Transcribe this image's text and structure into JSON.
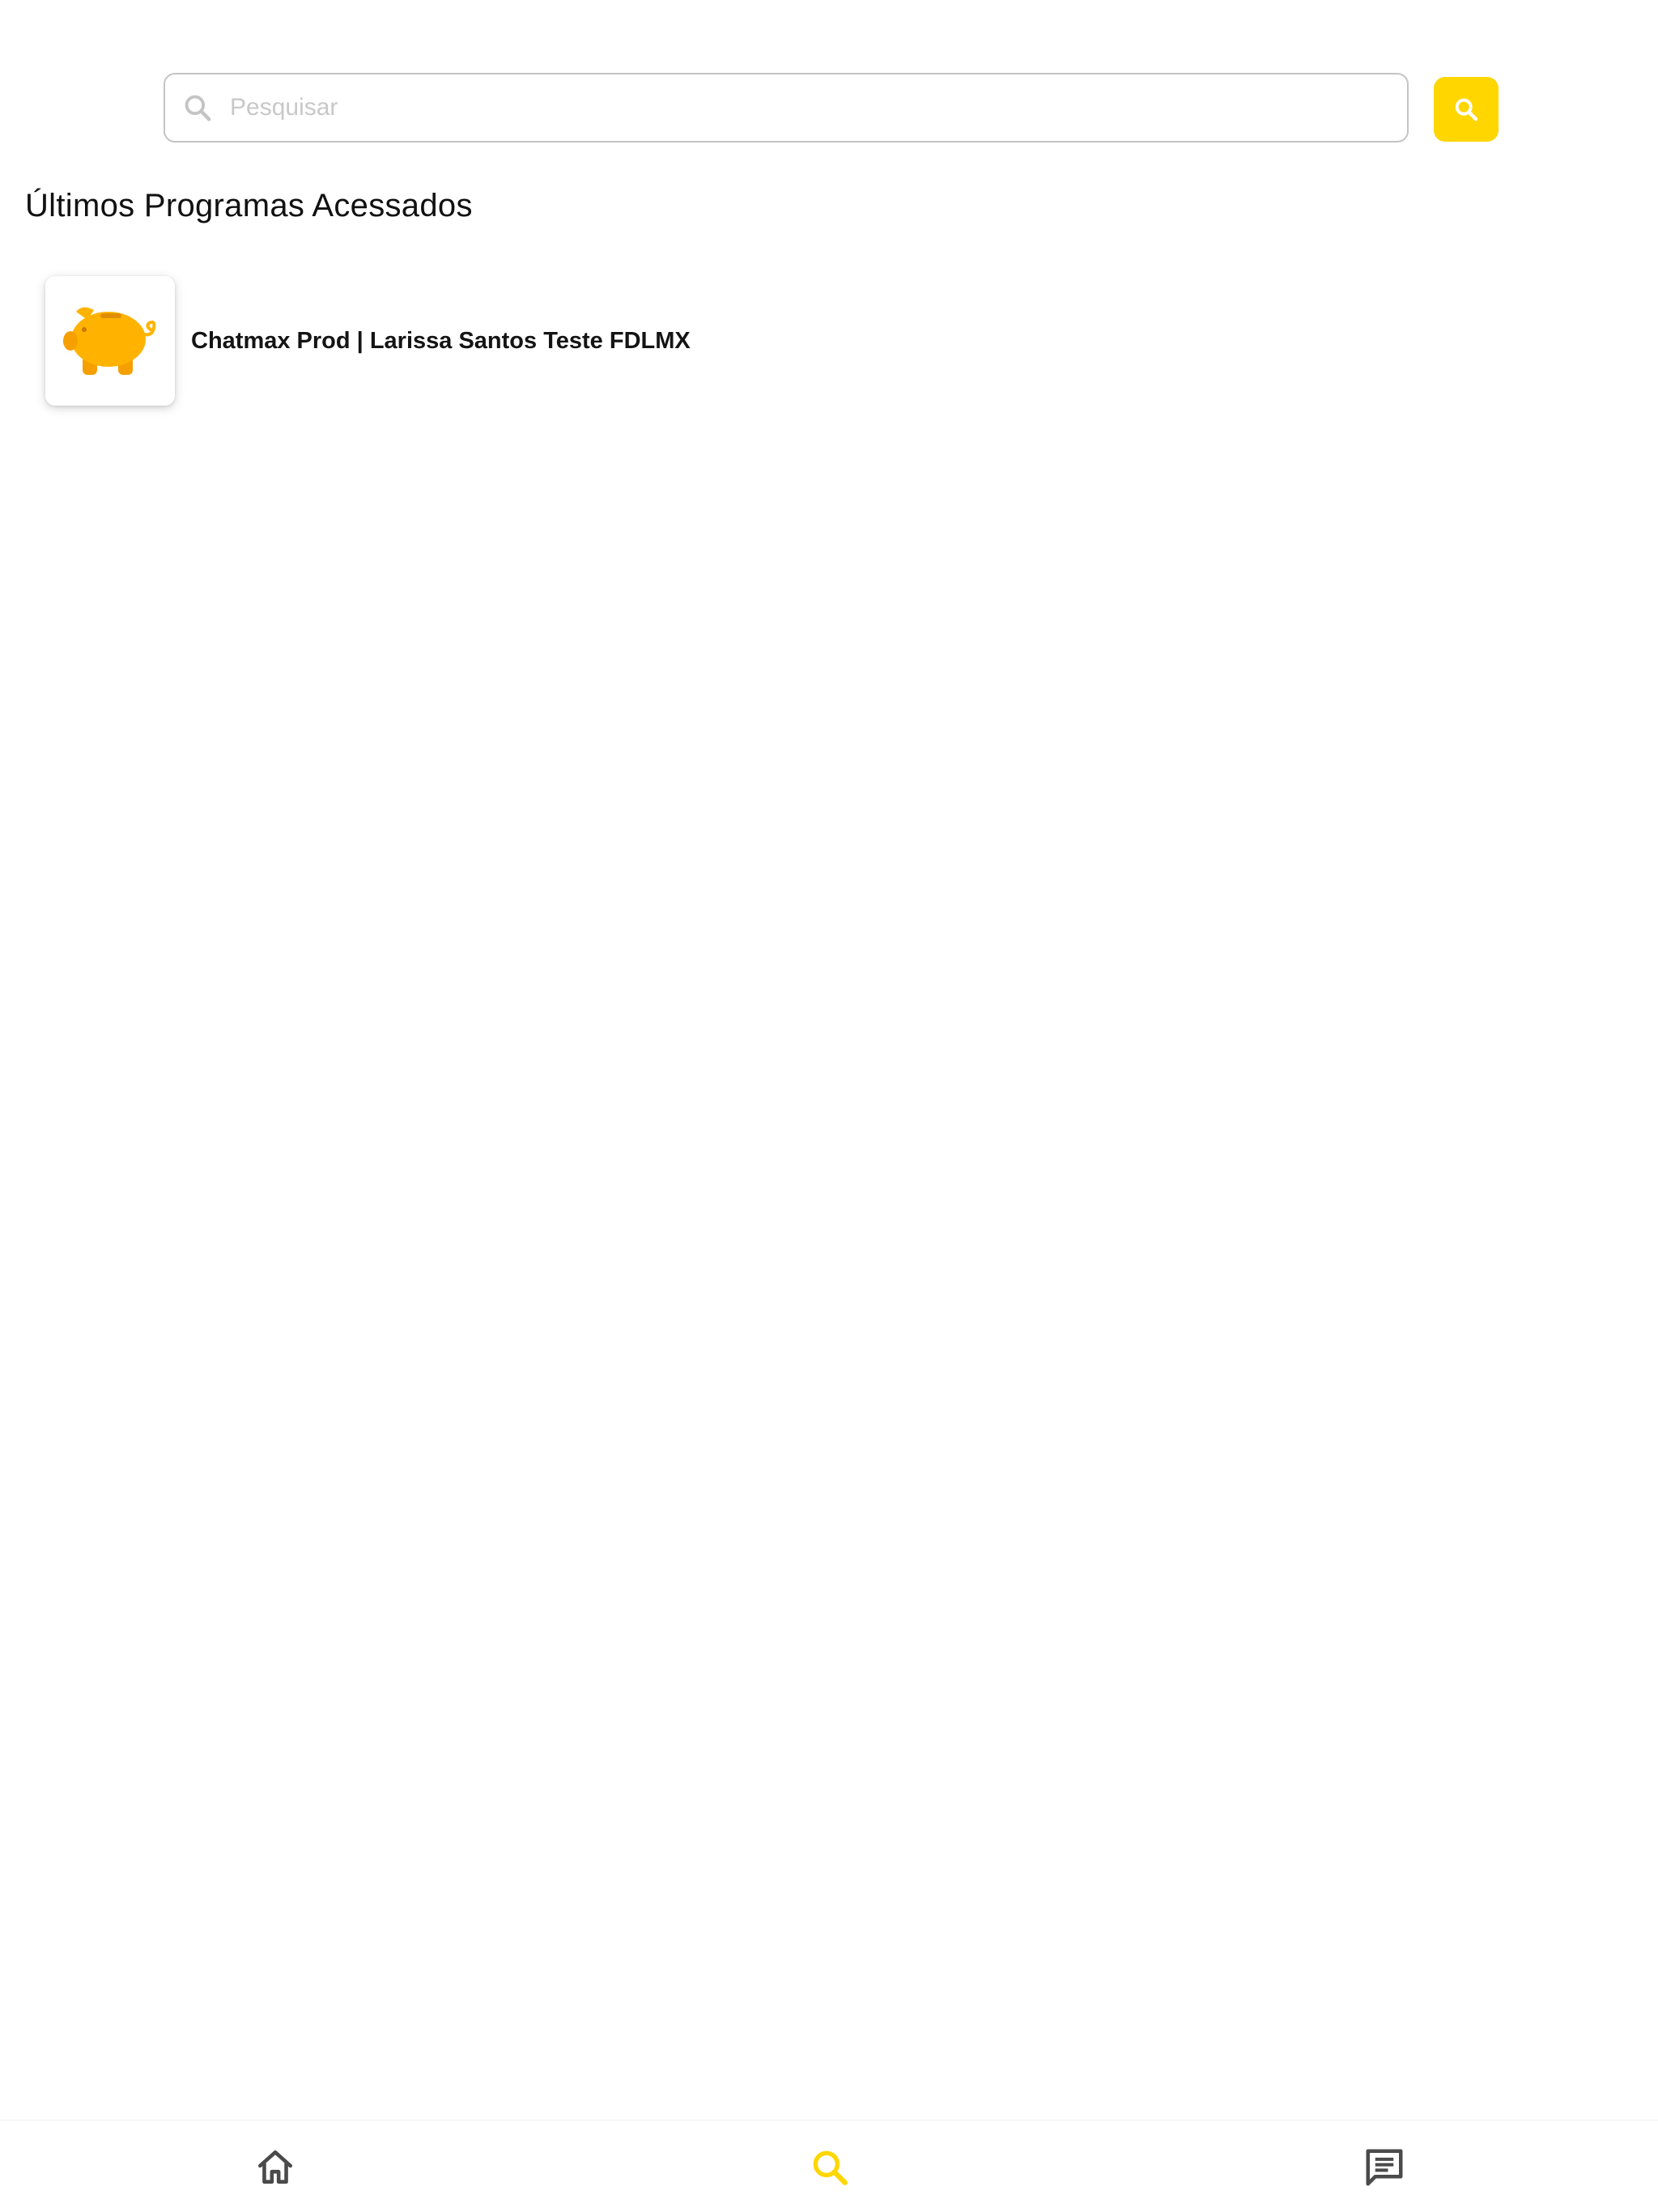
{
  "search": {
    "placeholder": "Pesquisar",
    "value": "",
    "input_icon": "search-icon",
    "button_icon": "search-icon"
  },
  "recent": {
    "title": "Últimos Programas Acessados",
    "items": [
      {
        "name": "Chatmax Prod | Larissa Santos Teste FDLMX",
        "icon": "piggy-bank-icon"
      }
    ]
  },
  "bottom_nav": {
    "items": [
      {
        "id": "home",
        "icon": "home-icon",
        "active": false
      },
      {
        "id": "search",
        "icon": "search-icon",
        "active": true
      },
      {
        "id": "messages",
        "icon": "chat-icon",
        "active": false
      }
    ]
  },
  "colors": {
    "accent": "#FFD600",
    "piggy": "#FFB300",
    "inactive_icon": "#4a4a4a",
    "placeholder_icon": "#c4c4c4"
  }
}
